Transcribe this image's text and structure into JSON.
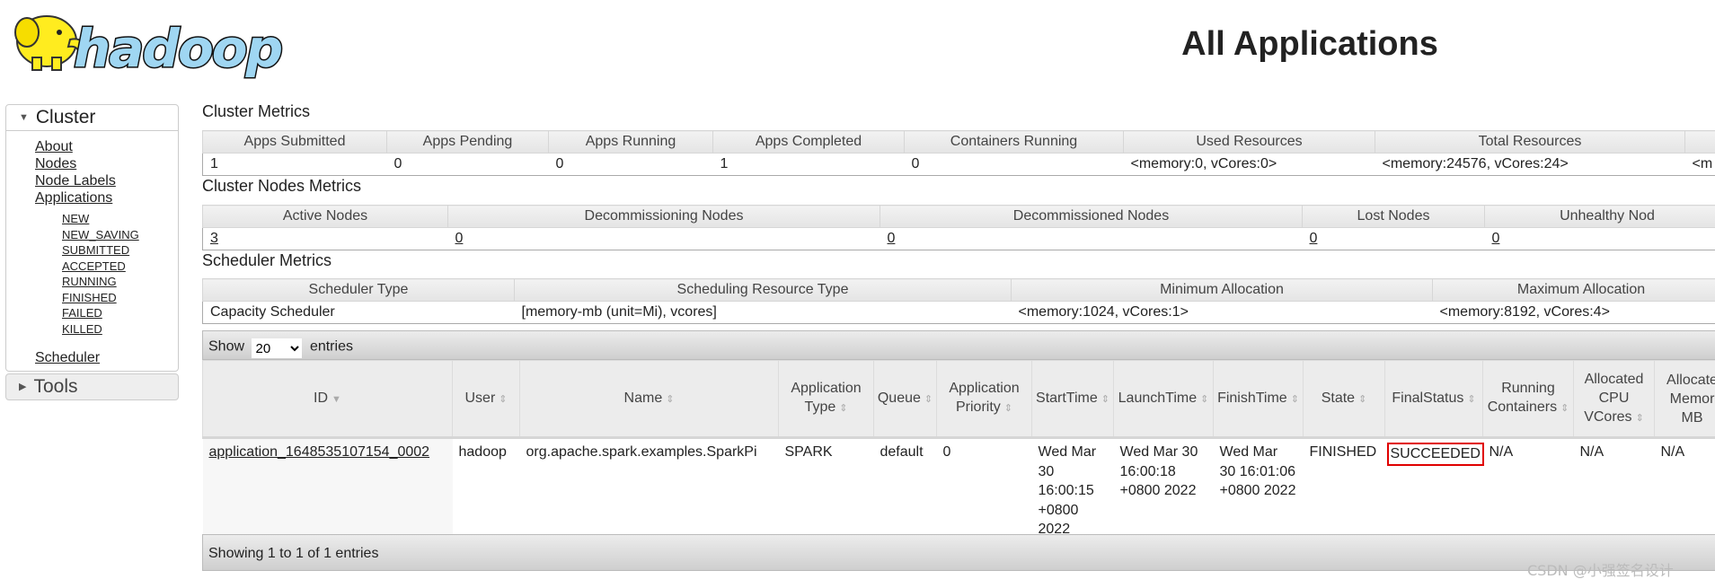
{
  "page": {
    "title": "All Applications"
  },
  "logo": {
    "text": "hadoop"
  },
  "sidebar": {
    "cluster": {
      "label": "Cluster",
      "links": [
        "About",
        "Nodes",
        "Node Labels",
        "Applications"
      ],
      "app_states": [
        "NEW",
        "NEW_SAVING",
        "SUBMITTED",
        "ACCEPTED",
        "RUNNING",
        "FINISHED",
        "FAILED",
        "KILLED"
      ],
      "scheduler": "Scheduler"
    },
    "tools": {
      "label": "Tools"
    }
  },
  "cluster_metrics": {
    "title": "Cluster Metrics",
    "headers": [
      "Apps Submitted",
      "Apps Pending",
      "Apps Running",
      "Apps Completed",
      "Containers Running",
      "Used Resources",
      "Total Resources",
      ""
    ],
    "values": [
      "1",
      "0",
      "0",
      "1",
      "0",
      "<memory:0, vCores:0>",
      "<memory:24576, vCores:24>",
      "<m"
    ]
  },
  "nodes_metrics": {
    "title": "Cluster Nodes Metrics",
    "headers": [
      "Active Nodes",
      "Decommissioning Nodes",
      "Decommissioned Nodes",
      "Lost Nodes",
      "Unhealthy Nod"
    ],
    "values": [
      "3",
      "0",
      "0",
      "0",
      "0"
    ]
  },
  "scheduler_metrics": {
    "title": "Scheduler Metrics",
    "headers": [
      "Scheduler Type",
      "Scheduling Resource Type",
      "Minimum Allocation",
      "Maximum Allocation"
    ],
    "values": [
      "Capacity Scheduler",
      "[memory-mb (unit=Mi), vcores]",
      "<memory:1024, vCores:1>",
      "<memory:8192, vCores:4>"
    ]
  },
  "apps": {
    "show_label": "Show",
    "entries_label": "entries",
    "page_size": "20",
    "headers": [
      "ID",
      "User",
      "Name",
      "Application Type",
      "Queue",
      "Application Priority",
      "StartTime",
      "LaunchTime",
      "FinishTime",
      "State",
      "FinalStatus",
      "Running Containers",
      "Allocated CPU VCores",
      "Allocate Memor MB"
    ],
    "rows": [
      [
        "application_1648535107154_0002",
        "hadoop",
        "org.apache.spark.examples.SparkPi",
        "SPARK",
        "default",
        "0",
        "Wed Mar 30 16:00:15 +0800 2022",
        "Wed Mar 30 16:00:18 +0800 2022",
        "Wed Mar 30 16:01:06 +0800 2022",
        "FINISHED",
        "SUCCEEDED",
        "N/A",
        "N/A",
        "N/A"
      ]
    ],
    "footer": "Showing 1 to 1 of 1 entries",
    "highlight_color": "#e00000"
  },
  "watermark": "CSDN @小强签名设计"
}
